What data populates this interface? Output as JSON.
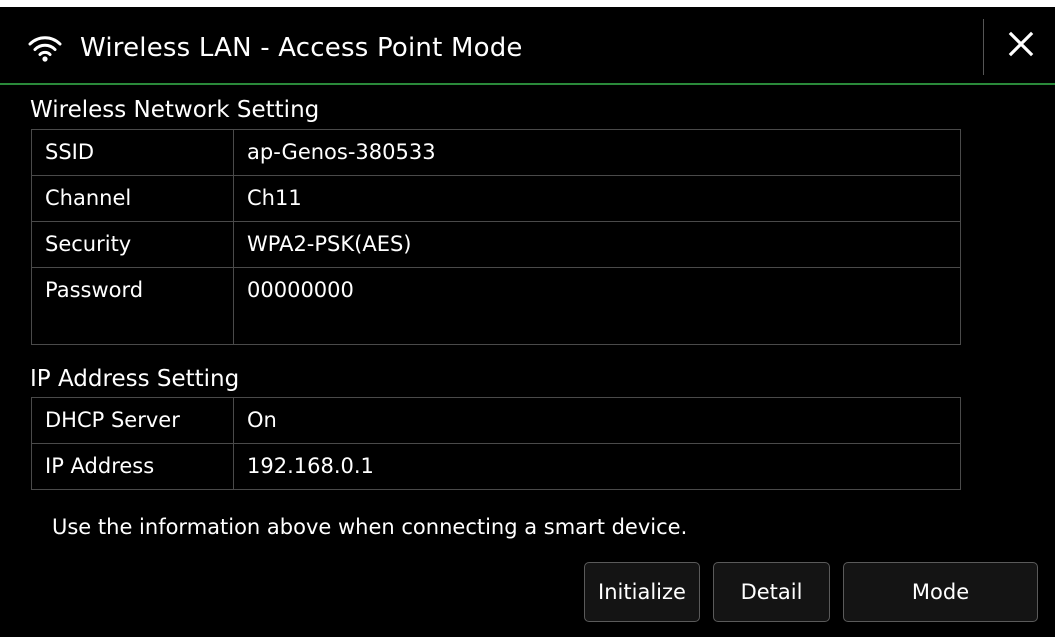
{
  "window": {
    "title": "Wireless LAN - Access Point Mode",
    "title_icon": "wifi-icon",
    "close_icon": "close-icon"
  },
  "wireless": {
    "title": "Wireless Network Setting",
    "rows": [
      {
        "label": "SSID",
        "value": "ap-Genos-380533"
      },
      {
        "label": "Channel",
        "value": "Ch11"
      },
      {
        "label": "Security",
        "value": "WPA2-PSK(AES)"
      },
      {
        "label": "Password",
        "value": "00000000"
      }
    ]
  },
  "ip": {
    "title": "IP Address Setting",
    "rows": [
      {
        "label": "DHCP Server",
        "value": "On"
      },
      {
        "label": "IP Address",
        "value": "192.168.0.1"
      }
    ]
  },
  "info_text": "Use the information above when connecting a smart device.",
  "buttons": {
    "initialize": "Initialize",
    "detail": "Detail",
    "mode": "Mode"
  },
  "colors": {
    "accent_line": "#2a8a3a",
    "background": "#000000"
  }
}
